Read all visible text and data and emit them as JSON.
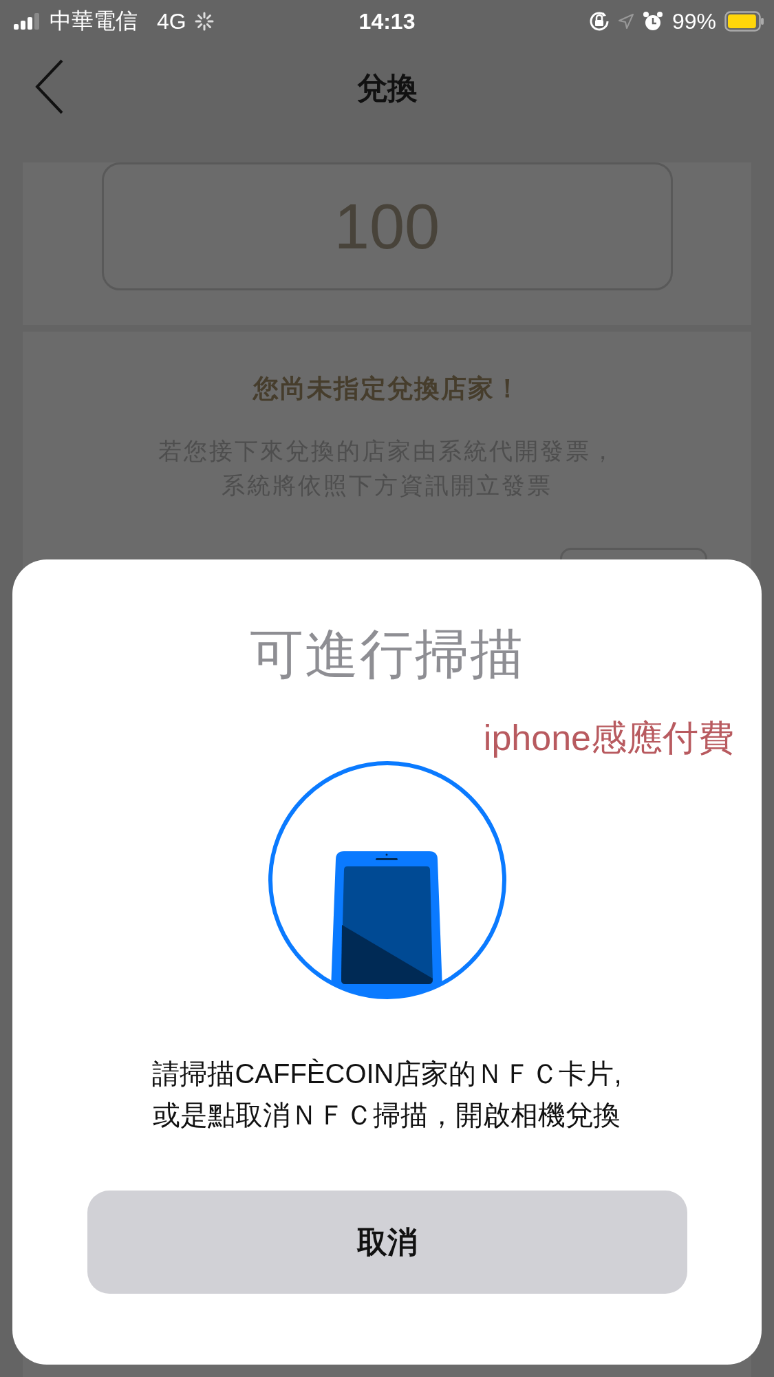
{
  "status_bar": {
    "carrier": "中華電信",
    "network": "4G",
    "time": "14:13",
    "battery": {
      "percent": "99%",
      "level": 0.95
    }
  },
  "nav": {
    "title": "兌換"
  },
  "amount": {
    "value": "100"
  },
  "notice": {
    "title": "您尚未指定兌換店家！",
    "lines": [
      "若您接下來兌換的店家由系統代開發票，",
      "系統將依照下方資訊開立發票"
    ]
  },
  "scan_sheet": {
    "title": "可進行掃描",
    "annotation": "iphone感應付費",
    "message_lines": [
      "請掃描CAFFÈCOIN店家的ＮＦＣ卡片,",
      "或是點取消ＮＦＣ掃描，開啟相機兌換"
    ],
    "cancel_button": "取消"
  }
}
